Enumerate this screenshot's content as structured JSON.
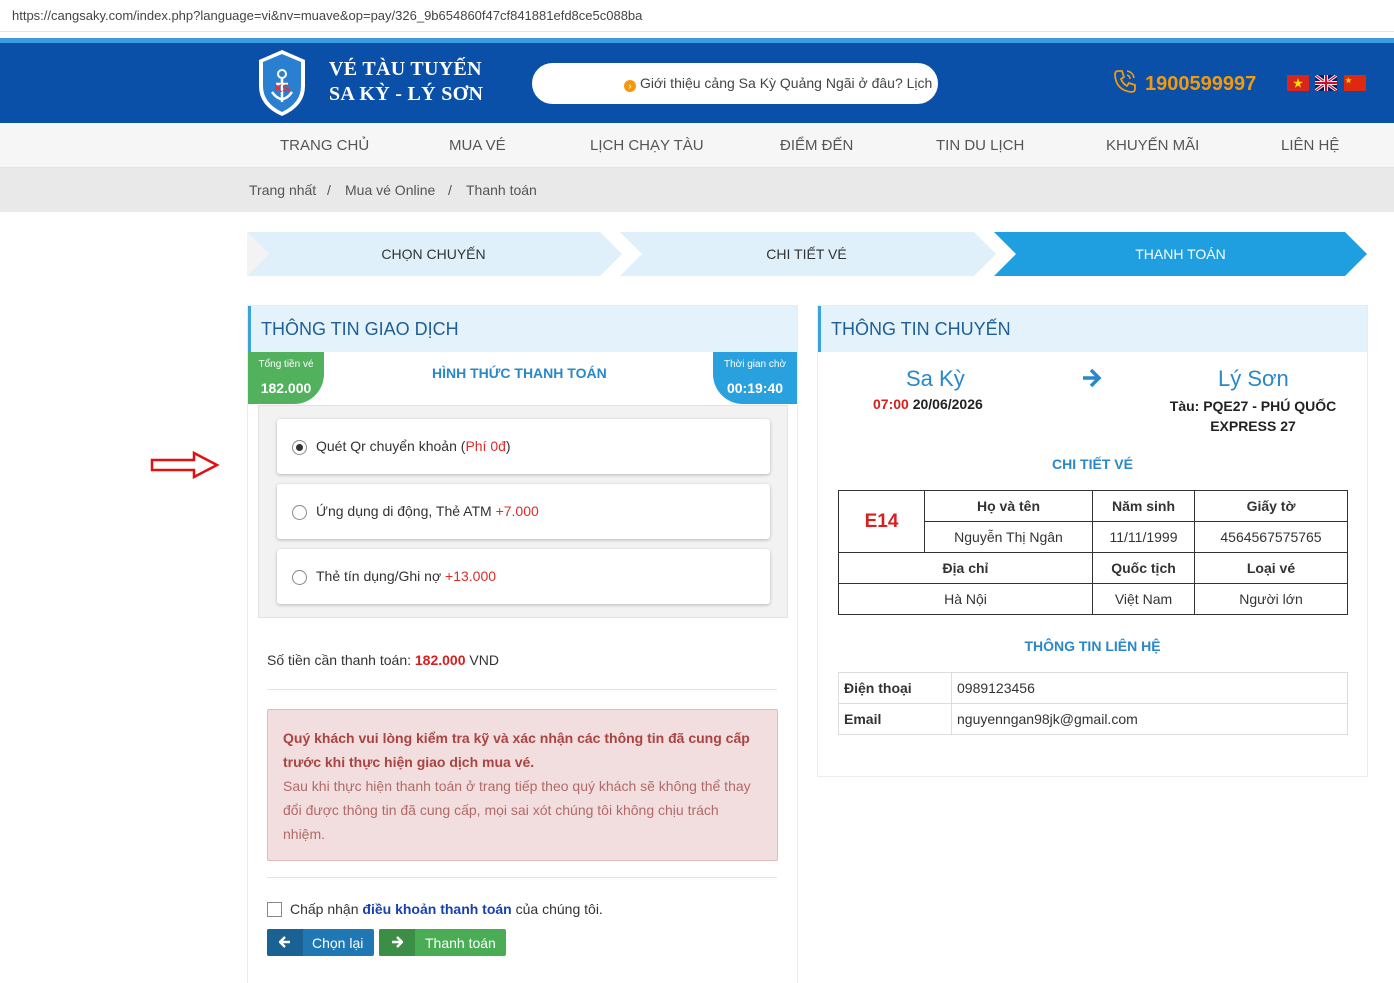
{
  "browser": {
    "url": "https://cangsaky.com/index.php?language=vi&nv=muave&op=pay/326_9b654860f47cf841881efd8ce5c088ba"
  },
  "header": {
    "brand_line1": "VÉ TÀU TUYẾN",
    "brand_line2": "SA KỲ - LÝ SƠN",
    "marquee_text": "Giới thiệu cảng Sa Kỳ Quảng Ngãi ở đâu? Lịch",
    "phone": "1900599997",
    "brand_color": "#0a4fa8",
    "accent_color": "#f29a0f"
  },
  "nav": {
    "items": [
      {
        "label": "TRANG CHỦ"
      },
      {
        "label": "MUA VÉ"
      },
      {
        "label": "LỊCH CHẠY TÀU"
      },
      {
        "label": "ĐIỂM ĐẾN"
      },
      {
        "label": "TIN DU LỊCH"
      },
      {
        "label": "KHUYẾN MÃI"
      },
      {
        "label": "LIÊN HỆ"
      }
    ]
  },
  "breadcrumb": {
    "items": [
      "Trang nhất",
      "Mua vé Online",
      "Thanh toán"
    ],
    "separator": "/"
  },
  "steps": {
    "items": [
      "CHỌN CHUYẾN",
      "CHI TIẾT VÉ",
      "THANH TOÁN"
    ],
    "active_index": 2
  },
  "transaction": {
    "title": "THÔNG TIN GIAO DỊCH",
    "total_label": "Tổng tiền vé",
    "total_value": "182.000",
    "method_title": "HÌNH THỨC THANH TOÁN",
    "wait_label": "Thời gian chờ",
    "wait_value": "00:19:40",
    "options": [
      {
        "label": "Quét Qr chuyển khoản",
        "fee": "(Phí 0đ)",
        "fee_suffix": ")",
        "checked": true
      },
      {
        "label": "Ứng dụng di động, Thẻ ATM",
        "fee": "+7.000",
        "checked": false
      },
      {
        "label": "Thẻ tín dụng/Ghi nợ",
        "fee": "+13.000",
        "checked": false
      }
    ],
    "amount_label": "Số tiền cần thanh toán:",
    "amount_value": "182.000",
    "amount_unit": "VND",
    "alert_bold": "Quý khách vui lòng kiểm tra kỹ và xác nhận các thông tin đã cung cấp trước khi thực hiện giao dịch mua vé.",
    "alert_text": "Sau khi thực hiện thanh toán ở trang tiếp theo quý khách sẽ không thể thay đổi được thông tin đã cung cấp, mọi sai xót chúng tôi không chịu trách nhiệm.",
    "terms_prefix": "Chấp nhận",
    "terms_link": "điều khoản thanh toán",
    "terms_suffix": "của chúng tôi.",
    "back_button": "Chọn lại",
    "pay_button": "Thanh toán"
  },
  "trip": {
    "title": "THÔNG TIN CHUYẾN",
    "from": "Sa Kỳ",
    "to": "Lý Sơn",
    "time": "07:00",
    "date": "20/06/2026",
    "ship": "Tàu: PQE27 - PHÚ QUỐC EXPRESS 27",
    "ticket_title": "CHI TIẾT VÉ",
    "ticket": {
      "seat": "E14",
      "headers": [
        "Họ và tên",
        "Năm sinh",
        "Giấy tờ"
      ],
      "values": [
        "Nguyễn Thị Ngân",
        "11/11/1999",
        "4564567575765"
      ],
      "headers2": [
        "Địa chỉ",
        "Quốc tịch",
        "Loại vé"
      ],
      "values2": [
        "Hà Nội",
        "Việt Nam",
        "Người lớn"
      ]
    },
    "contact_title": "THÔNG TIN LIÊN HỆ",
    "contact": [
      {
        "label": "Điện thoại",
        "value": "0989123456"
      },
      {
        "label": "Email",
        "value": "nguyenngan98jk@gmail.com"
      }
    ]
  }
}
